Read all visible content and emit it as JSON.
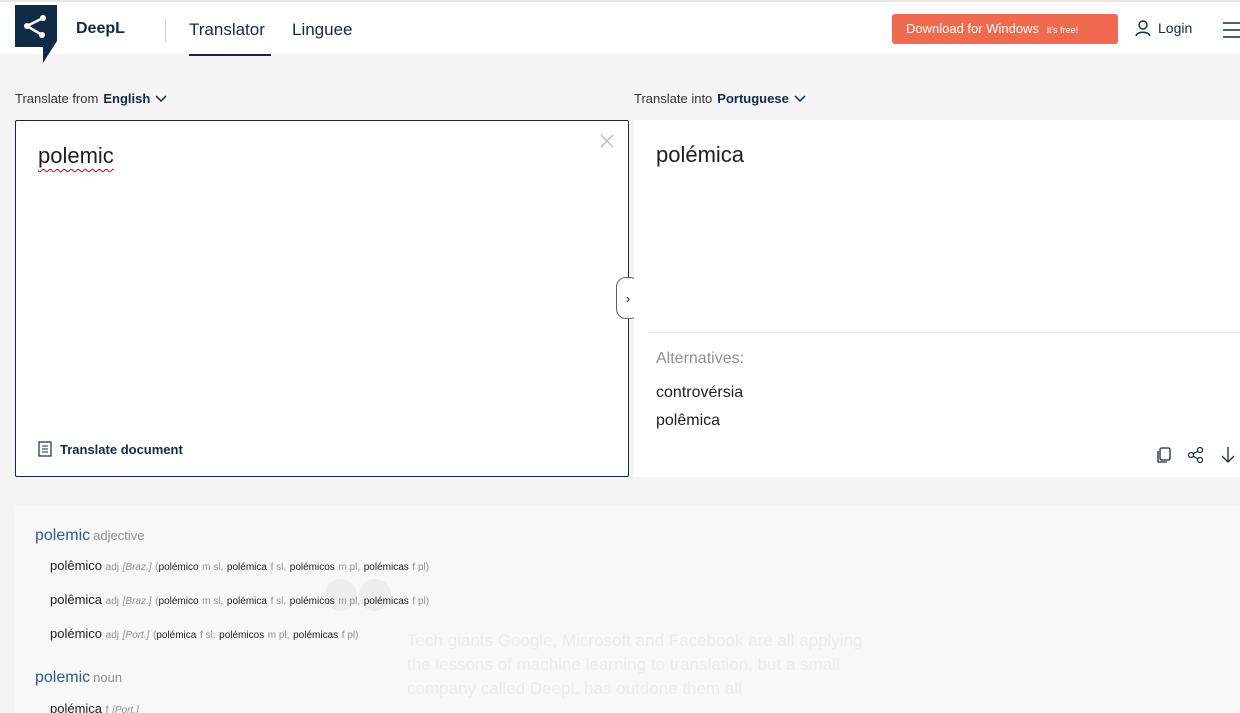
{
  "header": {
    "brand": "DeepL",
    "tabs": [
      "Translator",
      "Linguee"
    ],
    "download_label": "Download for Windows",
    "download_badge": "it's free!",
    "login_label": "Login"
  },
  "source": {
    "label_prefix": "Translate from",
    "language": "English",
    "text": "polemic",
    "translate_document": "Translate document"
  },
  "target": {
    "label_prefix": "Translate into",
    "language": "Portuguese",
    "text": "polémica",
    "alternatives_title": "Alternatives:",
    "alternatives": [
      "controvérsia",
      "polêmica"
    ]
  },
  "dictionary": {
    "entries": [
      {
        "headword": "polemic",
        "pos": "adjective",
        "senses": [
          {
            "word": "polêmico",
            "pos": "adj",
            "region": "[Braz.]",
            "forms": [
              {
                "w": "polémico",
                "g": "m sl"
              },
              {
                "w": "polémica",
                "g": "f sl"
              },
              {
                "w": "polémicos",
                "g": "m pl"
              },
              {
                "w": "polémicas",
                "g": "f pl"
              }
            ]
          },
          {
            "word": "polêmica",
            "pos": "adj",
            "region": "[Braz.]",
            "forms": [
              {
                "w": "polémico",
                "g": "m sl"
              },
              {
                "w": "polémica",
                "g": "f sl"
              },
              {
                "w": "polémicos",
                "g": "m pl"
              },
              {
                "w": "polémicas",
                "g": "f pl"
              }
            ]
          },
          {
            "word": "polémico",
            "pos": "adj",
            "region": "[Port.]",
            "forms": [
              {
                "w": "polémica",
                "g": "f sl"
              },
              {
                "w": "polémicos",
                "g": "m pl"
              },
              {
                "w": "polémicas",
                "g": "f pl"
              }
            ]
          }
        ]
      },
      {
        "headword": "polemic",
        "pos": "noun",
        "senses": [
          {
            "word": "polémica",
            "pos": "f",
            "region": "[Port.]",
            "forms": []
          }
        ]
      }
    ],
    "background_text": "Tech giants Google, Microsoft and Facebook are all applying the lessons of machine learning to translation, but a small company called DeepL has outdone them all"
  },
  "colors": {
    "brand_navy": "#0f2b46",
    "download_orange": "#f06a50",
    "headword_blue": "#2d5b8c",
    "spellcheck_red": "#d0021b"
  },
  "icons": [
    "deepl-logo-icon",
    "chevron-down-icon",
    "user-icon",
    "menu-icon",
    "close-icon",
    "document-icon",
    "chevron-right-icon",
    "copy-icon",
    "share-icon",
    "download-icon"
  ]
}
